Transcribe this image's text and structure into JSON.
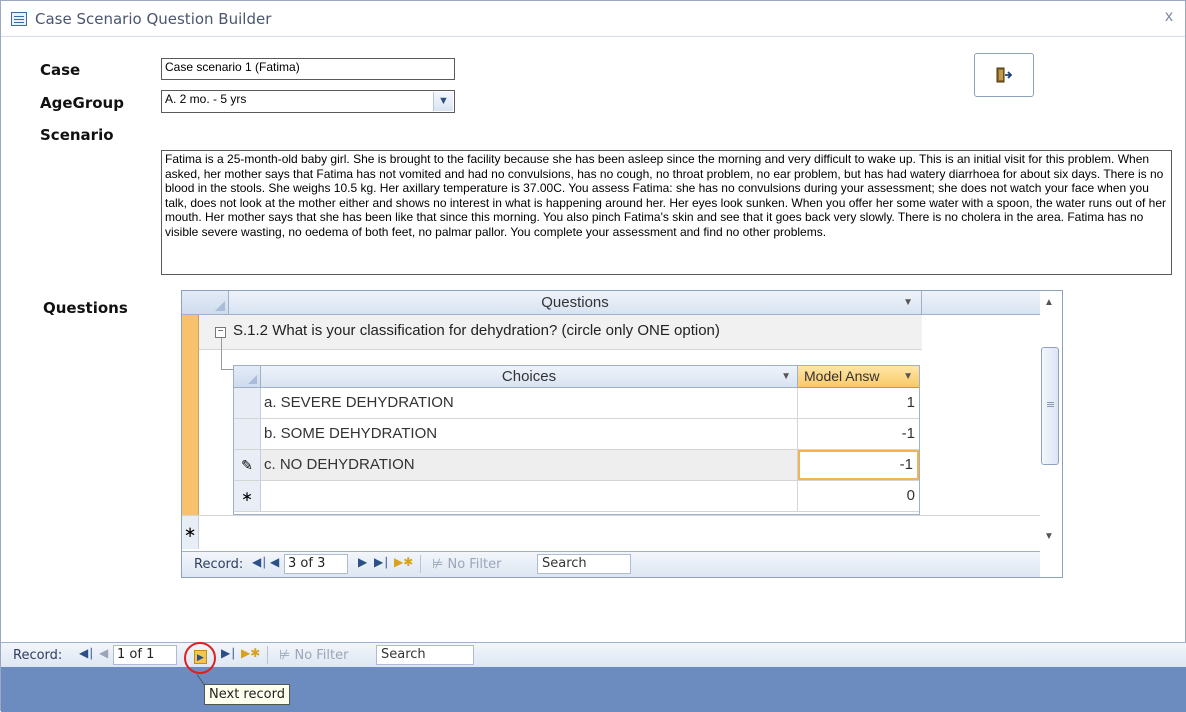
{
  "window": {
    "title": "Case Scenario Question Builder",
    "close_glyph": "x"
  },
  "form": {
    "case_label": "Case",
    "case_value": "Case scenario 1 (Fatima)",
    "agegroup_label": "AgeGroup",
    "agegroup_value": "A. 2 mo. - 5 yrs",
    "scenario_label": "Scenario",
    "scenario_text": "Fatima is a 25-month-old baby girl. She is brought to the facility because she has been asleep since the morning and very difficult to wake up. This is an initial visit for this problem. When asked, her mother says that Fatima has not vomited and had no convulsions, has no cough, no throat problem, no ear problem, but has had watery diarrhoea for about six days. There is no blood in the stools. She weighs 10.5 kg. Her axillary temperature is 37.00C. You assess Fatima: she has no convulsions during your assessment; she does not watch your face when you talk, does not look at the mother either and shows no interest in what is happening around her. Her eyes look sunken. When you offer her some water with a spoon, the water runs out of her mouth. Her mother says that she has been like that since this morning. You also pinch Fatima's skin and see that it goes back very slowly. There is no cholera in the area. Fatima has no visible severe wasting, no oedema of both feet, no palmar pallor. You complete your assessment and find no other problems.",
    "questions_label": "Questions"
  },
  "subform": {
    "header": "Questions",
    "question_text": "S.1.2 What is your classification for dehydration? (circle only ONE option)",
    "expander_glyph": "−",
    "choices_header": "Choices",
    "model_answer_header": "Model Answ",
    "rows": [
      {
        "choice": "a. SEVERE DEHYDRATION",
        "answer": "1",
        "selector": ""
      },
      {
        "choice": "b. SOME DEHYDRATION",
        "answer": "-1",
        "selector": ""
      },
      {
        "choice": "c. NO DEHYDRATION",
        "answer": "-1",
        "selector": "✎"
      },
      {
        "choice": "",
        "answer": "0",
        "selector": "∗"
      }
    ],
    "new_row_glyph": "∗",
    "nav": {
      "record_label": "Record:",
      "record_value": "3 of 3",
      "filter_label": "No Filter",
      "search_label": "Search"
    }
  },
  "main_nav": {
    "record_label": "Record:",
    "record_value": "1 of 1",
    "filter_label": "No Filter",
    "search_label": "Search",
    "tooltip": "Next record"
  },
  "colors": {
    "accent_orange": "#f7c26b",
    "status_blue": "#6c8bbf",
    "highlight_red": "#e02020"
  }
}
